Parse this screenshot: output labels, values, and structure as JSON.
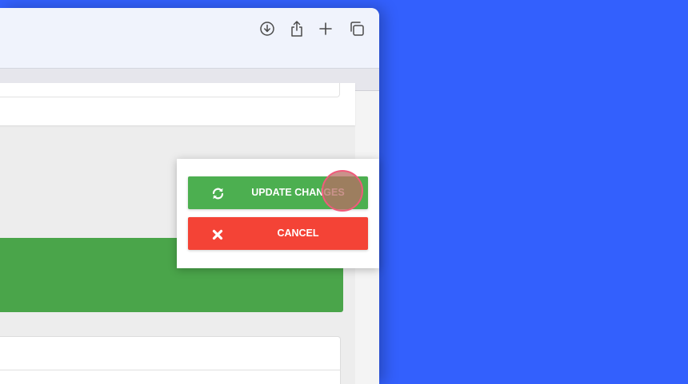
{
  "browser_toolbar": {
    "icons": [
      "download-icon",
      "share-icon",
      "new-tab-icon",
      "tab-overview-icon"
    ]
  },
  "popup": {
    "update_button": {
      "label": "UPDATE CHANGES",
      "icon": "refresh-icon",
      "color": "#4caf50"
    },
    "cancel_button": {
      "label": "CANCEL",
      "icon": "close-icon",
      "color": "#f44336"
    }
  },
  "colors": {
    "desktop_background": "#3360fd",
    "banner_green": "#4aa54a",
    "cursor_highlight": "#f05b7b"
  }
}
